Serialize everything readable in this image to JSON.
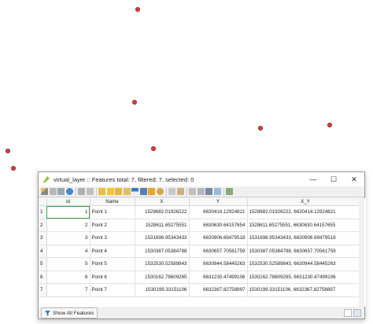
{
  "window": {
    "title": "virtual_layer :: Features total: 7, filtered: 7, selected: 0",
    "minimize_icon": "minimize-icon",
    "maximize_icon": "maximize-icon",
    "close_icon": "close-icon"
  },
  "table": {
    "columns": [
      "id",
      "Name",
      "X",
      "Y",
      "X_Y"
    ],
    "rows": [
      {
        "num": "1",
        "id": "1",
        "name": "Point 1",
        "x": "1528682.01926222",
        "y": "6630414.12924821",
        "xy": "1528682.01926222, 6630414.12924821"
      },
      {
        "num": "2",
        "id": "2",
        "name": "Point 2",
        "x": "1528611.65275551",
        "y": "6630630.64157654",
        "xy": "1528611.65275551, 6630630.64157655"
      },
      {
        "num": "3",
        "id": "3",
        "name": "Point 3",
        "x": "1531696.95343433",
        "y": "6630906.69479518",
        "xy": "1531696.95343433, 6630906.69479518"
      },
      {
        "num": "4",
        "id": "4",
        "name": "Point 4",
        "x": "1530387.05384788",
        "y": "6630657.70561759",
        "xy": "1530387.05384788, 6630657.70561759"
      },
      {
        "num": "5",
        "id": "5",
        "name": "Point 5",
        "x": "1532530.52589843",
        "y": "6630944.58445263",
        "xy": "1532530.52589843, 6630944.58445263"
      },
      {
        "num": "6",
        "id": "6",
        "name": "Point 6",
        "x": "1530162.78609265",
        "y": "6631230.47499106",
        "xy": "1530162.78609265, 6631230.47499106"
      },
      {
        "num": "7",
        "id": "7",
        "name": "Point 7",
        "x": "1530199.33151106",
        "y": "6632367.82758897",
        "xy": "1530199.33151106, 6632367.82758897"
      }
    ]
  },
  "statusbar": {
    "show_all_label": "Show All Features"
  },
  "colors": {
    "point_fill": "#d94040",
    "selection_outline": "#3aa05a"
  }
}
